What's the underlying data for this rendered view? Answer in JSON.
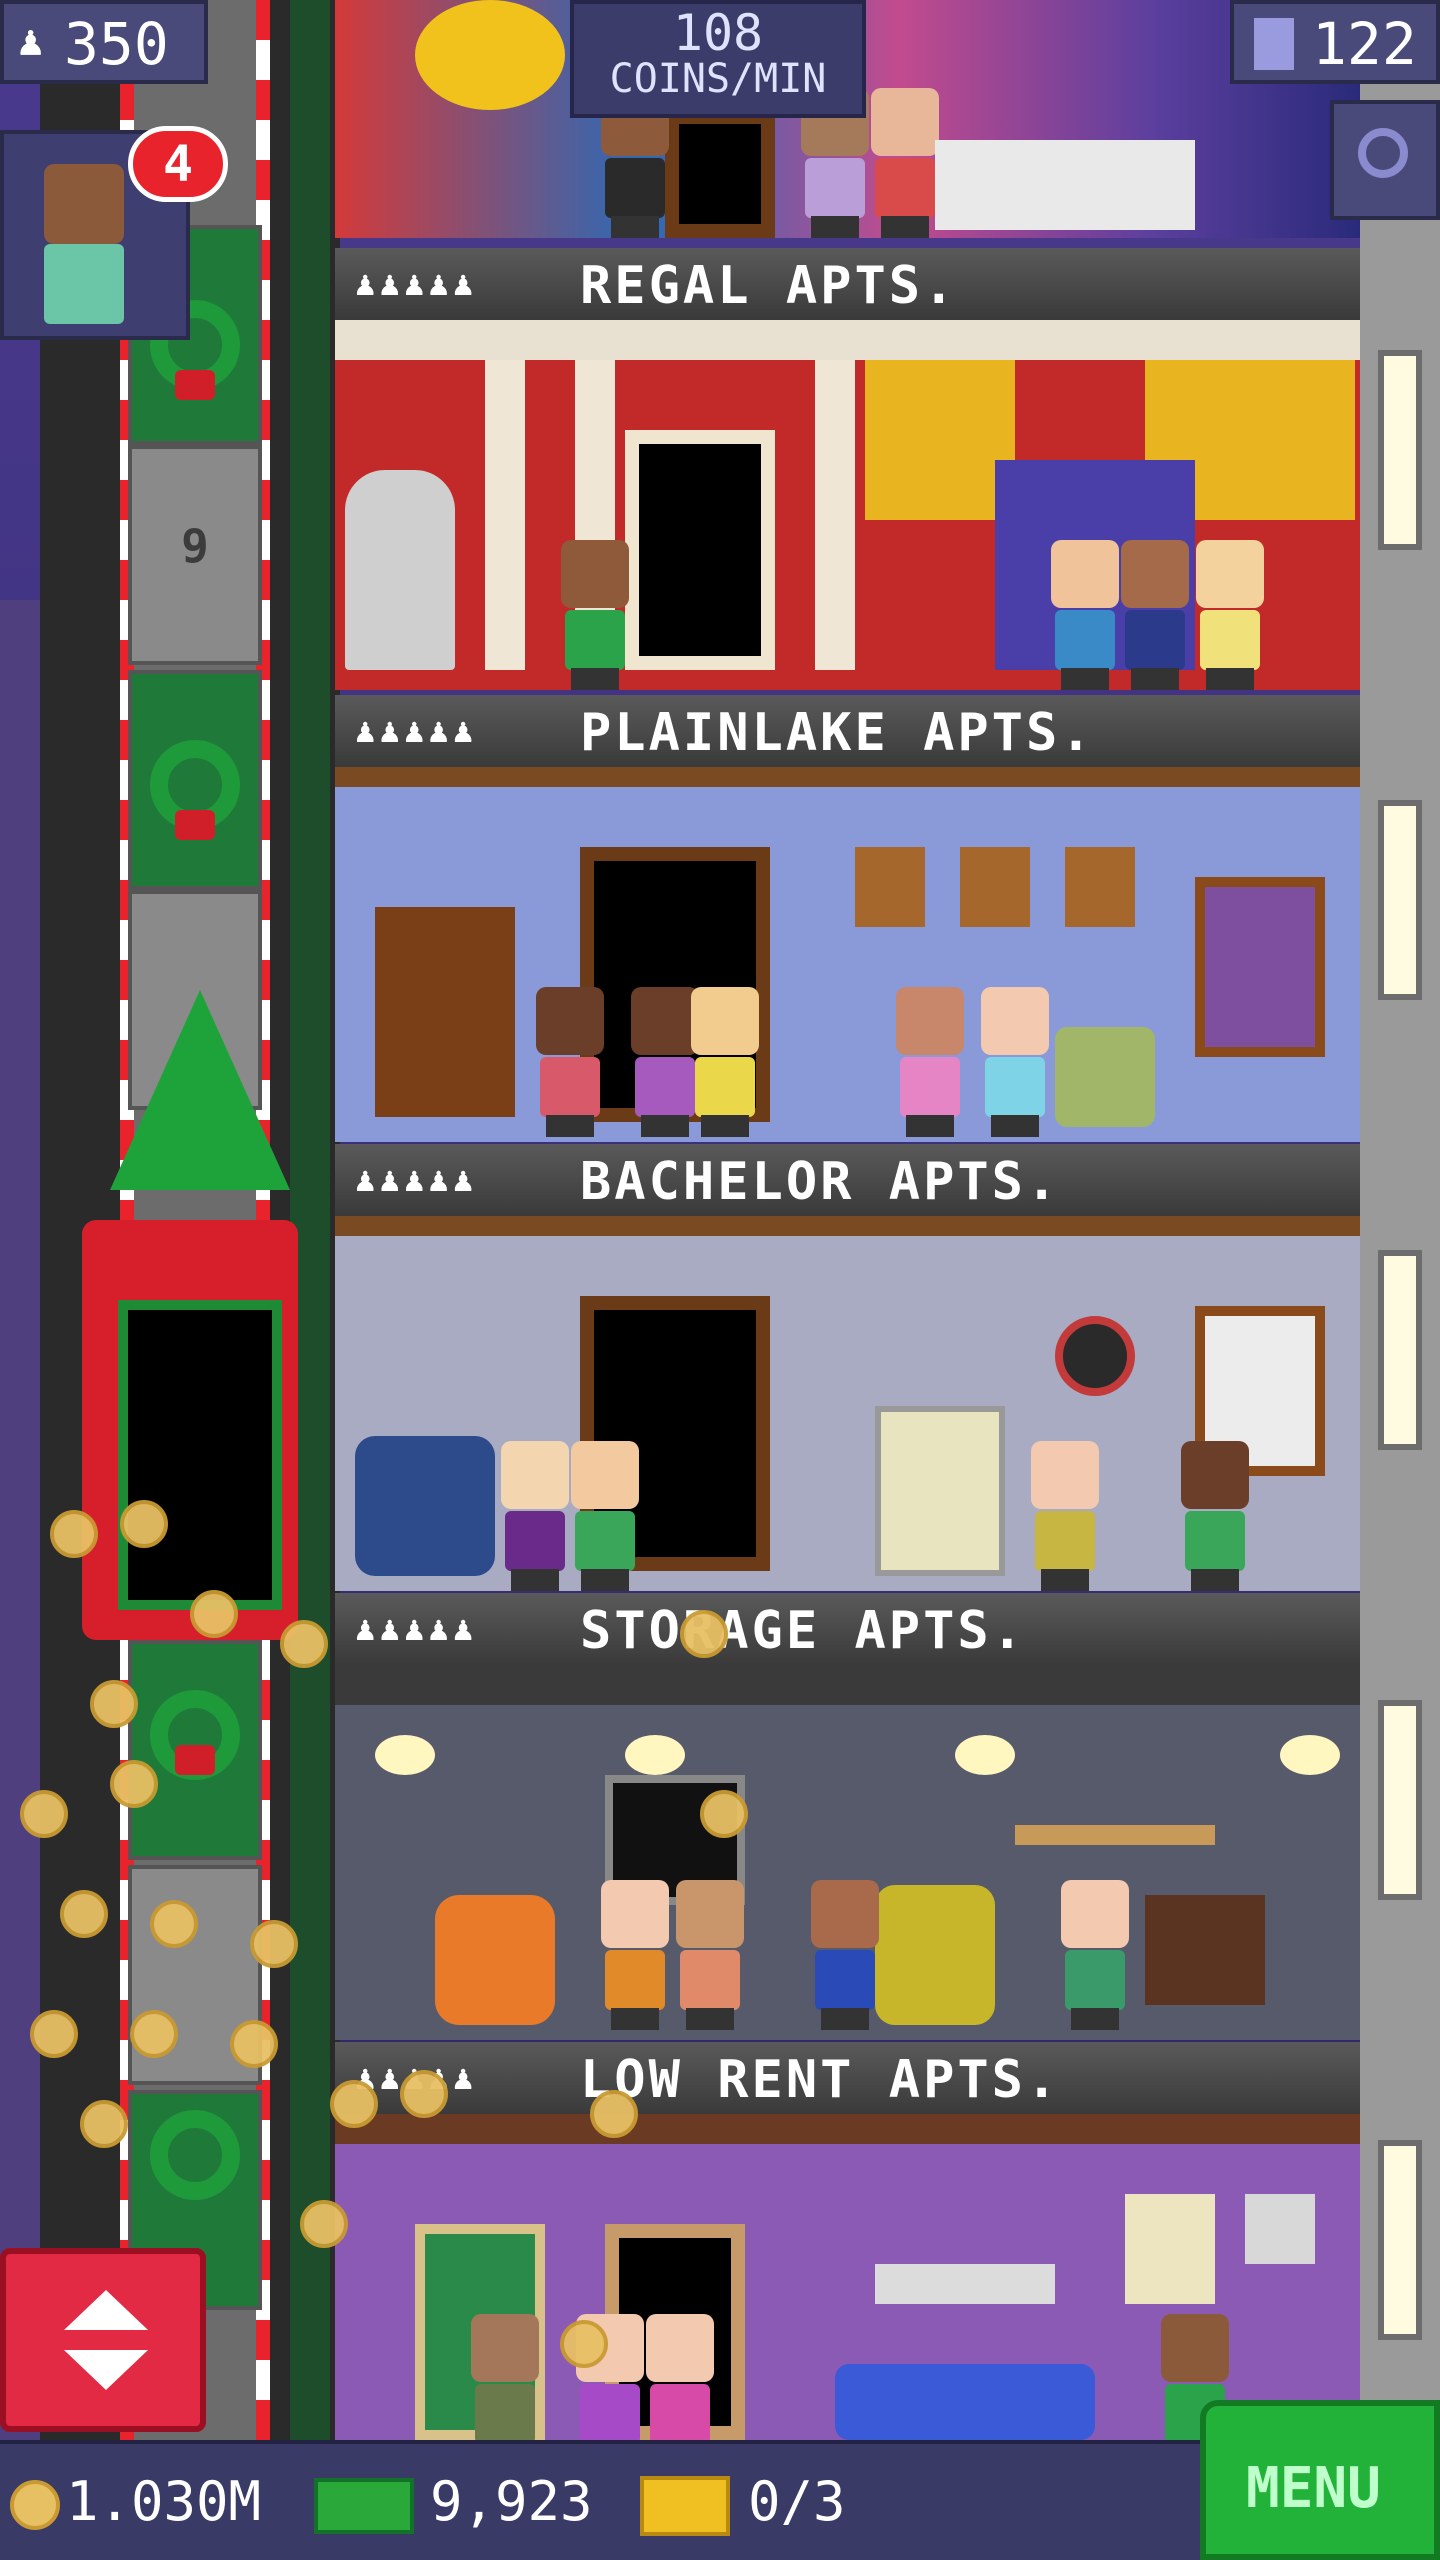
{
  "hud": {
    "population": "350",
    "coin_rate_value": "108",
    "coin_rate_unit": "COINS/MIN",
    "floors_count": "122",
    "badge_count": "4"
  },
  "shaft": {
    "floor_number": "9"
  },
  "floors": [
    {
      "name": "REGAL APTS.",
      "stars": "♟♟♟♟♟"
    },
    {
      "name": "PLAINLAKE APTS.",
      "stars": "♟♟♟♟♟"
    },
    {
      "name": "BACHELOR APTS.",
      "stars": "♟♟♟♟♟"
    },
    {
      "name": "STORAGE APTS.",
      "stars": "♟♟♟♟♟"
    },
    {
      "name": "LOW RENT APTS.",
      "stars": "♟♟♟♟♟"
    }
  ],
  "bottom": {
    "coins": "1.030M",
    "bux": "9,923",
    "tickets": "0/3",
    "menu_label": "MENU"
  },
  "colors": {
    "accent_red": "#e22a44",
    "menu_green": "#22b23a",
    "hud_bg": "#3a3a66"
  }
}
